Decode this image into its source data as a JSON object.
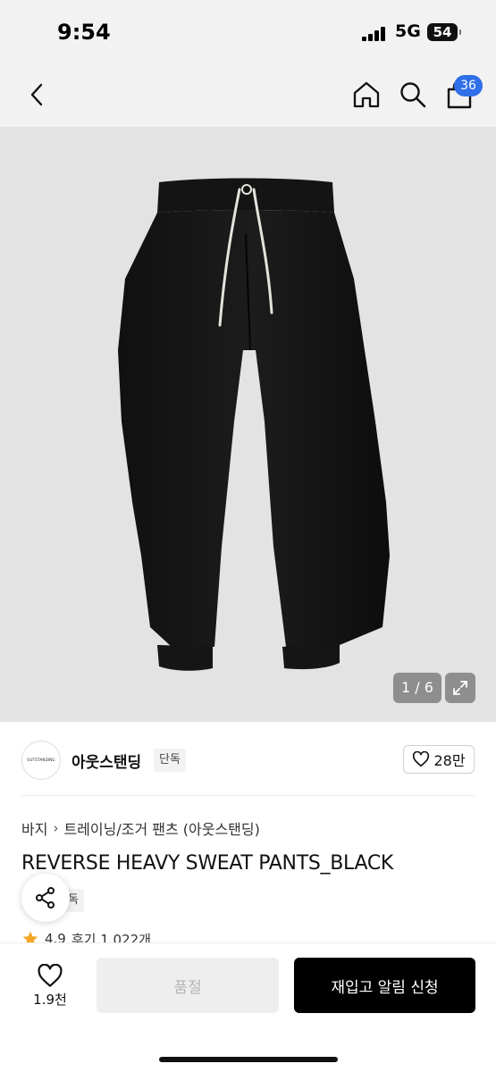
{
  "status_bar": {
    "time": "9:54",
    "network": "5G",
    "battery": "54"
  },
  "header": {
    "back_icon": "chevron-left-icon",
    "home_icon": "home-icon",
    "search_icon": "search-icon",
    "cart_icon": "shopping-bag-icon",
    "cart_count": "36",
    "badge_color": "#2f6fe8"
  },
  "gallery": {
    "counter": "1 / 6",
    "expand_icon": "expand-icon"
  },
  "brand": {
    "logo_text": "OUTSTANDING",
    "name": "아웃스탠딩",
    "tag": "단독",
    "likes": "28만"
  },
  "product": {
    "breadcrumb": [
      "바지",
      "트레이닝/조거 팬츠 (아웃스탠딩)"
    ],
    "title": "REVERSE HEAVY SWEAT PANTS_BLACK",
    "tag": "단독",
    "rating": "4.9",
    "reviews": "후기 1,022개"
  },
  "bottom_bar": {
    "wish_count": "1.9천",
    "soldout_label": "품절",
    "restock_label": "재입고 알림 신청"
  }
}
